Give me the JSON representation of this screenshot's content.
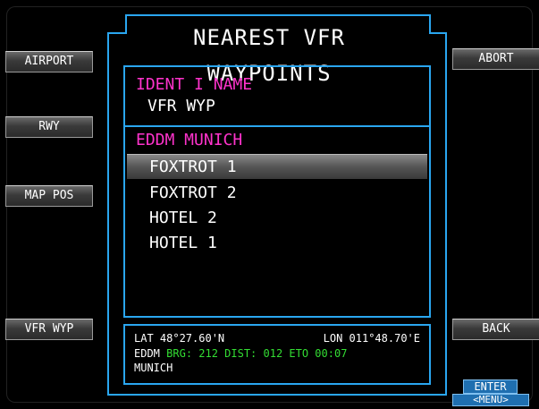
{
  "title": "NEAREST VFR WAYPOINTS",
  "softkeys_left": [
    "AIRPORT",
    "RWY",
    "MAP POS",
    "VFR WYP"
  ],
  "softkeys_right": [
    "ABORT",
    "BACK"
  ],
  "list": {
    "header_ident_name": "IDENT I NAME",
    "header_type": "VFR WYP",
    "airport": "EDDM MUNICH",
    "items": [
      "FOXTROT 1",
      "FOXTROT 2",
      "HOTEL 2",
      "HOTEL 1"
    ],
    "selected_index": 0
  },
  "info": {
    "lat": "LAT 48°27.60'N",
    "lon": "LON 011°48.70'E",
    "ident": "EDDM",
    "brg_dist_eto": "BRG: 212 DIST: 012  ETO 00:07",
    "name": "MUNICH"
  },
  "enter_label": "ENTER",
  "menu_label": "<MENU>",
  "colors": {
    "frame": "#2aa6f0",
    "magenta": "#ff33cc",
    "green": "#33dd33"
  }
}
